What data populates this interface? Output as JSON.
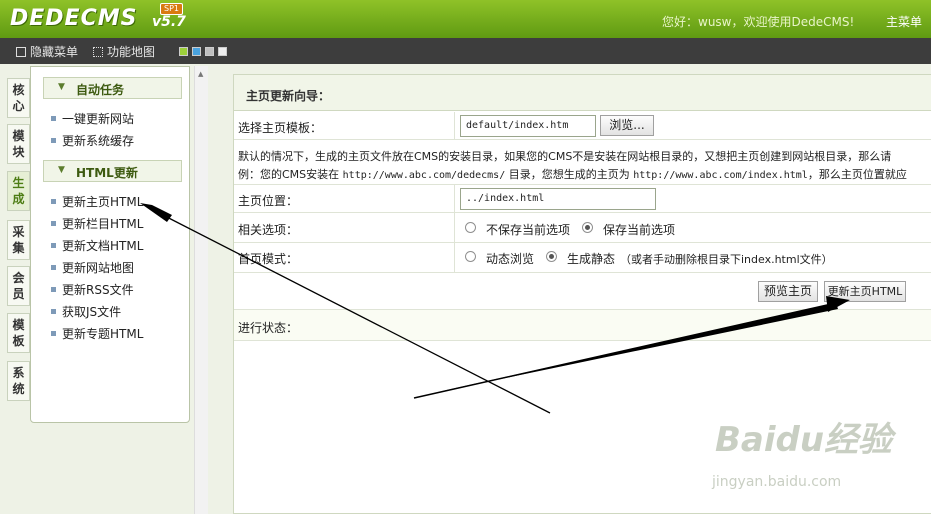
{
  "header": {
    "logo_text": "DEDECMS",
    "logo_version": "v5.7",
    "logo_badge": "SP1",
    "welcome": "您好：wusw，欢迎使用DedeCMS!",
    "main_menu_label": "主菜单"
  },
  "toolbar": {
    "hide_menu_label": "隐藏菜单",
    "site_map_label": "功能地图",
    "swatches": [
      "#9ccf3a",
      "#4aa3df",
      "#bfbfbf",
      "#eeeeee"
    ]
  },
  "vertical_tabs": [
    {
      "label": "核心"
    },
    {
      "label": "模块"
    },
    {
      "label": "生成",
      "active": true
    },
    {
      "label": "采集"
    },
    {
      "label": "会员"
    },
    {
      "label": "模板"
    },
    {
      "label": "系统"
    }
  ],
  "left_panel": {
    "sections": [
      {
        "title": "自动任务",
        "items": [
          "一键更新网站",
          "更新系统缓存"
        ]
      },
      {
        "title": "HTML更新",
        "items": [
          "更新主页HTML",
          "更新栏目HTML",
          "更新文档HTML",
          "更新网站地图",
          "更新RSS文件",
          "获取JS文件",
          "更新专题HTML"
        ]
      }
    ]
  },
  "content": {
    "title": "主页更新向导：",
    "template_label": "选择主页模板：",
    "template_value": "default/index.htm",
    "browse_button": "浏览...",
    "description_line1": "默认的情况下，生成的主页文件放在CMS的安装目录，如果您的CMS不是安装在网站根目录的，又想把主页创建到网站根目录，那么请",
    "description_line2_a": "例：您的CMS安装在 ",
    "description_line2_url1": "http://www.abc.com/dedecms/",
    "description_line2_b": " 目录，您想生成的主页为 ",
    "description_line2_url2": "http://www.abc.com/index.html",
    "description_line2_c": "，那么主页位置就应",
    "position_label": "主页位置：",
    "position_value": "../index.html",
    "options_label": "相关选项：",
    "option_no_save": "不保存当前选项",
    "option_save": "保存当前选项",
    "mode_label": "首页模式：",
    "mode_dynamic": "动态浏览",
    "mode_static": "生成静态",
    "mode_static_note": "（或者手动删除根目录下index.html文件）",
    "preview_button": "预览主页",
    "update_button": "更新主页HTML",
    "status_label": "进行状态："
  },
  "watermark": {
    "brand": "Baidu经验",
    "url": "jingyan.baidu.com"
  }
}
